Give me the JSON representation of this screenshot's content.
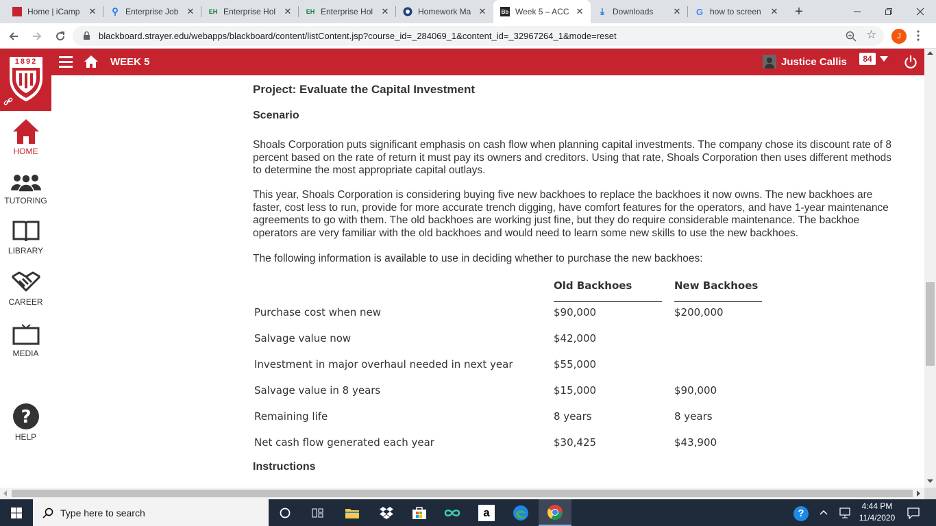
{
  "browser": {
    "tabs": [
      {
        "title": "Home | iCamp"
      },
      {
        "title": "Enterprise Job"
      },
      {
        "title": "Enterprise Hol"
      },
      {
        "title": "Enterprise Hol"
      },
      {
        "title": "Homework Ma"
      },
      {
        "title": "Week 5 – ACC"
      },
      {
        "title": "Downloads"
      },
      {
        "title": "how to screen"
      }
    ],
    "url": "blackboard.strayer.edu/webapps/blackboard/content/listContent.jsp?course_id=_284069_1&content_id=_32967264_1&mode=reset",
    "profile_initial": "J"
  },
  "header": {
    "logo_year": "1892",
    "week_title": "WEEK 5",
    "user_name": "Justice Callis",
    "notification_count": "84"
  },
  "sidebar": {
    "items": [
      {
        "label": "HOME"
      },
      {
        "label": "TUTORING"
      },
      {
        "label": "LIBRARY"
      },
      {
        "label": "CAREER"
      },
      {
        "label": "MEDIA"
      },
      {
        "label": "HELP"
      }
    ]
  },
  "content": {
    "project_title": "Project: Evaluate the Capital Investment",
    "scenario_heading": "Scenario",
    "para1": "Shoals Corporation puts significant emphasis on cash flow when planning capital investments. The company chose its discount rate of 8 percent based on the rate of return it must pay its owners and creditors. Using that rate, Shoals Corporation then uses different methods to determine the most appropriate capital outlays.",
    "para2": "This year, Shoals Corporation is considering buying five new backhoes to replace the backhoes it now owns. The new backhoes are faster, cost less to run, provide for more accurate trench digging, have comfort features for the operators, and have 1-year maintenance agreements to go with them. The old backhoes are working just fine, but they do require considerable maintenance. The backhoe operators are very familiar with the old backhoes and would need to learn some new skills to use the new backhoes.",
    "para3": "The following information is available to use in deciding whether to purchase the new backhoes:",
    "table": {
      "col_old": "Old Backhoes",
      "col_new": "New Backhoes",
      "rows": [
        {
          "label": "Purchase cost when new",
          "old": "$90,000",
          "new": "$200,000"
        },
        {
          "label": "Salvage value now",
          "old": "$42,000",
          "new": ""
        },
        {
          "label": "Investment in major overhaul needed in next year",
          "old": "$55,000",
          "new": ""
        },
        {
          "label": "Salvage value in 8 years",
          "old": "$15,000",
          "new": "$90,000"
        },
        {
          "label": "Remaining life",
          "old": "8 years",
          "new": "8 years"
        },
        {
          "label": "Net cash flow generated each year",
          "old": "$30,425",
          "new": "$43,900"
        }
      ]
    },
    "instructions_heading": "Instructions"
  },
  "taskbar": {
    "search_placeholder": "Type here to search",
    "time": "4:44 PM",
    "date": "11/4/2020"
  },
  "colors": {
    "brand_red": "#c5242f",
    "taskbar": "#1f2a3b"
  }
}
